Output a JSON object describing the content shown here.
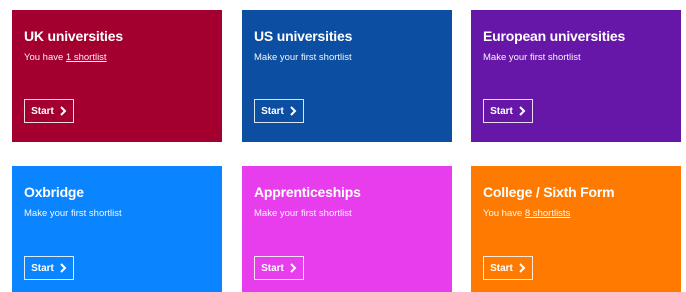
{
  "cards": [
    {
      "title": "UK universities",
      "subtitle_prefix": "You have ",
      "subtitle_link": "1 shortlist",
      "subtitle": "",
      "button": "Start",
      "color": "#A3002F"
    },
    {
      "title": "US universities",
      "subtitle_prefix": "",
      "subtitle_link": "",
      "subtitle": "Make your first shortlist",
      "button": "Start",
      "color": "#0B4EA2"
    },
    {
      "title": "European universities",
      "subtitle_prefix": "",
      "subtitle_link": "",
      "subtitle": "Make your first shortlist",
      "button": "Start",
      "color": "#6717A8"
    },
    {
      "title": "Oxbridge",
      "subtitle_prefix": "",
      "subtitle_link": "",
      "subtitle": "Make your first shortlist",
      "button": "Start",
      "color": "#0A84FF"
    },
    {
      "title": "Apprenticeships",
      "subtitle_prefix": "",
      "subtitle_link": "",
      "subtitle": "Make your first shortlist",
      "button": "Start",
      "color": "#E83DED"
    },
    {
      "title": "College / Sixth Form",
      "subtitle_prefix": "You have ",
      "subtitle_link": "8 shortlists",
      "subtitle": "",
      "button": "Start",
      "color": "#FF7A00"
    }
  ],
  "icons": {
    "button_icon": "chevron-right-icon"
  }
}
